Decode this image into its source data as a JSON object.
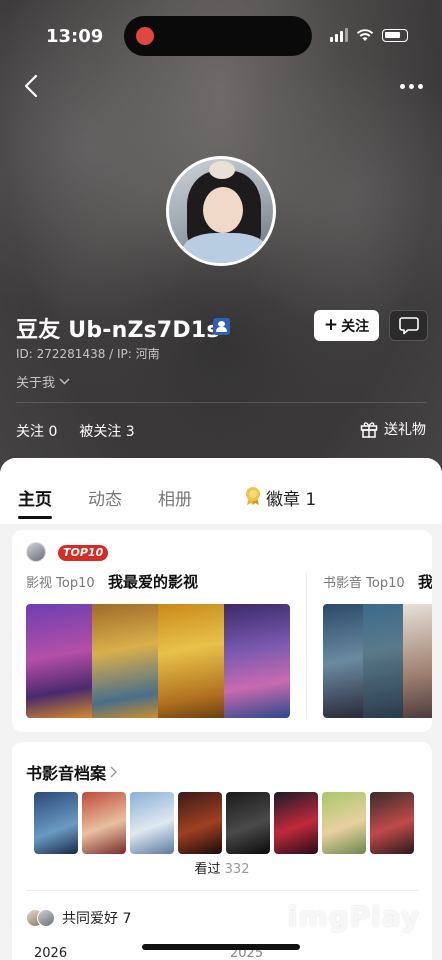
{
  "status_bar": {
    "time": "13:09"
  },
  "profile": {
    "name": "豆友 Ub-nZs7D1s",
    "id_ip": "ID: 272281438 / IP: 河南",
    "about": "关于我",
    "follow_label": "关注",
    "following": "关注 0",
    "followers": "被关注 3",
    "gift_label": "送礼物"
  },
  "tabs": [
    {
      "label": "主页"
    },
    {
      "label": "动态"
    },
    {
      "label": "相册"
    },
    {
      "label": "徽章"
    }
  ],
  "badge_count": "1",
  "top_lists": {
    "badge": "TOP10",
    "film_label": "影视 Top10",
    "film_title": "我最爱的影视",
    "book_label": "书影音 Top10",
    "book_title": "我"
  },
  "archive": {
    "title": "书影音档案",
    "seen_label": "看过",
    "seen_count": "332",
    "common_label": "共同爱好 7",
    "year_a": "2026",
    "year_b": "2025"
  },
  "watermark": "imgPlay",
  "colors": {
    "accent_red": "#d92b25",
    "verify_blue": "#2f5fb8"
  }
}
